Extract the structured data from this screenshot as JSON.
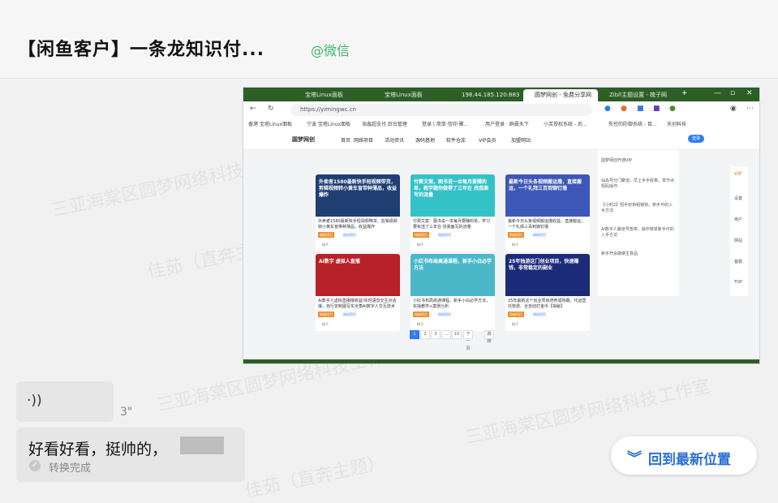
{
  "chat": {
    "title": "【闲鱼客户】一条龙知识付...",
    "source": "@微信"
  },
  "watermarks": [
    "三亚海棠区圆梦网络科技工作室",
    "佳茹（直奔主题）",
    "佳茹（直奔主题）"
  ],
  "screenshot": {
    "tabs": [
      "宝塔Linux面板",
      "宝塔Linux面板",
      "198.44.185.120:8836",
      "圆梦网创 - 免费分享网",
      "Zibll主题设置 - 梳子网"
    ],
    "url": "https://yimingwc.cn",
    "bookmarks": [
      "香港 宝塔Linux面板",
      "宁波 宝塔Linux面板",
      "海鑫超支付 后台管理",
      "登录 | 简单·信仰·聚...",
      "用户登录 · 群晨天下",
      "小芙授权系统 - 后...",
      "失控的防御系统 - 目...",
      "天创科技"
    ],
    "site_nav": [
      "首页",
      "网络项目",
      "活动资讯",
      "源码基地",
      "软件仓库",
      "VIP会员",
      "加盟网站"
    ],
    "login": "登录",
    "cards": [
      {
        "thumb": "外卖者1580最新快手短视频带货，剪辑视频转小黄车盲带种薄品，收益爆炸",
        "title": "外卖者1580最新快手短视频带货，剪辑视频转小黄车盲带种薄品，收益爆炸",
        "tag": "网络项目",
        "tag2": "网创项目",
        "author": "梳子",
        "color": "#1f3f73"
      },
      {
        "thumb": "付费文案，图书说一本每月要赚的单，教学题你做得了三年在 找我面写的流量",
        "title": "付费文案：图书说一本每月要赚的单，学习要有选了三年在 找我面写的流量",
        "tag": "网络项目",
        "tag2": "网创项目",
        "author": "梳子",
        "color": "#33c2c8"
      },
      {
        "thumb": "最新今日头条视频搬运撸，直接搬运，一个礼拜三百到铆钉撸",
        "title": "最新今日头条视频搬运撸收益，直接搬运，一个礼拜三百到铆钉撸",
        "tag": "网络项目",
        "tag2": "网创项目",
        "author": "梳子",
        "color": "#3c57b8"
      },
      {
        "thumb": "Ai数字 虚拟人直播",
        "title": "Ai数字人虚拟直播撸收益/实时语音交互对话接，自行定制图写实全角AI数字人交互技术",
        "tag": "网络项目",
        "tag2": "网创项目",
        "author": "梳子",
        "color": "#b8212a"
      },
      {
        "thumb": "小红书布局高通课程，新手小白必学方法",
        "title": "小红书布局高通课程，新手小白必学方法，实操教学+案例分析",
        "tag": "网络项目",
        "tag2": "网创项目",
        "author": "梳子",
        "color": "#4bb8c9"
      },
      {
        "thumb": "25年独游这门创业项目，快速赚钱，非常稳定的副业",
        "title": "25年最新这个创业项目培养成熟期，代运营托管费、全自动打金币【揭秘】",
        "tag": "网络项目",
        "tag2": "网创项目",
        "author": "梳子",
        "color": "#1b2b7a"
      }
    ],
    "right_panel": [
      "圆梦网创开通VIP",
      "仙岛号分门聚道，早上手手收率，单节点短码操作",
      "【小时2】短手好钩组锁钩，新手可的入手方法",
      "Ai数字人聚道号暂停，操作简单新手可的入手方法",
      "新手开会做做生意品"
    ],
    "rail": [
      "VIP",
      "设置",
      "用户",
      "网站",
      "客服",
      "TOP"
    ],
    "pager": [
      "1",
      "2",
      "3",
      "...",
      "10",
      "下一页",
      "跳转"
    ]
  },
  "voice": {
    "duration": "3\""
  },
  "transcript": {
    "text": "好看好看，挺帅的，",
    "status": "转换完成"
  },
  "back_button": {
    "label": "回到最新位置"
  }
}
